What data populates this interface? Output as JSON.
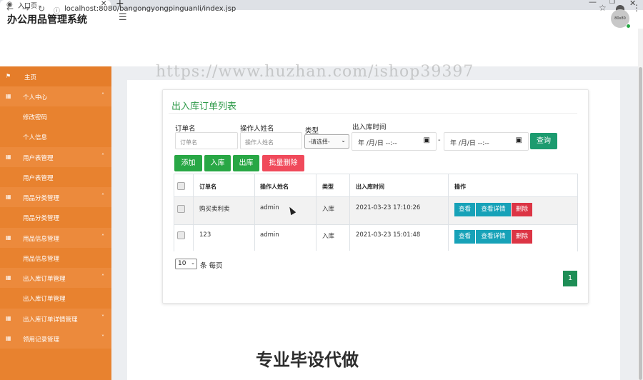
{
  "browser": {
    "tab_title": "入口页",
    "url": "localhost:8080/bangongyongpinguanli/index.jsp"
  },
  "header": {
    "app_title": "办公用品管理系统",
    "avatar_text": "80x80"
  },
  "sidebar": {
    "items": [
      {
        "label": "主页"
      },
      {
        "label": "个人中心"
      },
      {
        "label": "修改密码"
      },
      {
        "label": "个人信息"
      },
      {
        "label": "用户表管理"
      },
      {
        "label": "用户表管理"
      },
      {
        "label": "用品分类管理"
      },
      {
        "label": "用品分类管理"
      },
      {
        "label": "用品信息管理"
      },
      {
        "label": "用品信息管理"
      },
      {
        "label": "出入库订单管理"
      },
      {
        "label": "出入库订单管理"
      },
      {
        "label": "出入库订单详情管理"
      },
      {
        "label": "领用记录管理"
      }
    ]
  },
  "card": {
    "title": "出入库订单列表"
  },
  "filters": {
    "order_label": "订单名",
    "order_placeholder": "订单名",
    "operator_label": "操作人姓名",
    "operator_placeholder": "操作人姓名",
    "type_label": "类型",
    "type_selected": "-请选择-",
    "time_label": "出入库时间",
    "date_placeholder": "年 /月/日 --:--",
    "date_sep": "-",
    "query_button": "查询"
  },
  "actions": {
    "add": "添加",
    "in": "入库",
    "out": "出库",
    "batch_delete": "批量删除"
  },
  "table": {
    "headers": [
      "订单名",
      "操作人姓名",
      "类型",
      "出入库时间",
      "操作"
    ],
    "rows": [
      {
        "name": "购买卖利卖",
        "operator": "admin",
        "type": "入库",
        "time": "2021-03-23 17:10:26"
      },
      {
        "name": "123",
        "operator": "admin",
        "type": "入库",
        "time": "2021-03-23 15:01:48"
      }
    ],
    "row_actions": {
      "view": "查看",
      "detail": "查看详情",
      "delete": "删除"
    }
  },
  "pagination": {
    "page_size": "10",
    "page_size_text": "条 每页",
    "current_page": "1"
  },
  "watermarks": {
    "url": "https://www.huzhan.com/ishop39397",
    "bottom": "专业毕设代做"
  },
  "colors": {
    "sidebar": "#e8822f",
    "title_green": "#2f9a4a",
    "button_green": "#28a745",
    "button_red": "#f04a5b",
    "button_cyan": "#17a2b8"
  }
}
